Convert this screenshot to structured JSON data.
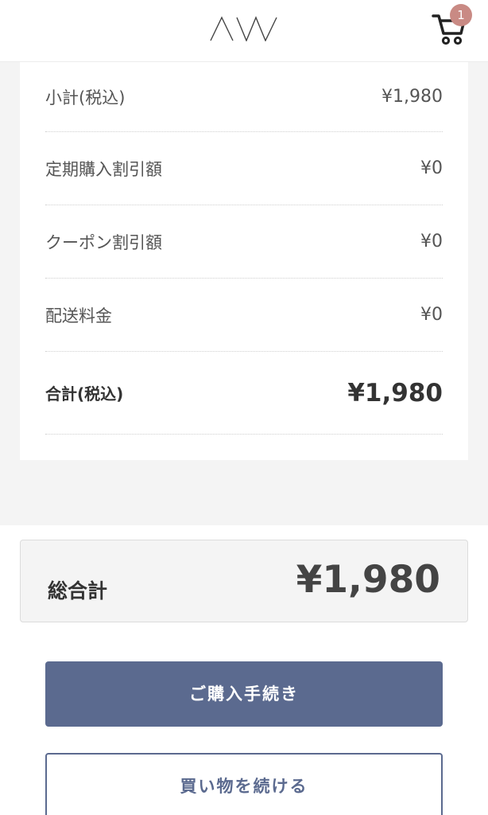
{
  "header": {
    "logo_icon": "aw-logo-icon",
    "cart_icon": "cart-icon",
    "cart_count": "1"
  },
  "summary": {
    "rows": [
      {
        "label": "小計(税込)",
        "value": "¥1,980"
      },
      {
        "label": "定期購入割引額",
        "value": "¥0"
      },
      {
        "label": "クーポン割引額",
        "value": "¥0"
      },
      {
        "label": "配送料金",
        "value": "¥0"
      }
    ],
    "total": {
      "label": "合計(税込)",
      "value": "¥1,980"
    }
  },
  "grand_total": {
    "label": "総合計",
    "value": "¥1,980"
  },
  "buttons": {
    "checkout": "ご購入手続き",
    "continue_shopping": "買い物を続ける"
  },
  "colors": {
    "primary": "#5b6a8f",
    "badge": "#c98a84",
    "background_grey": "#f4f4f4"
  }
}
